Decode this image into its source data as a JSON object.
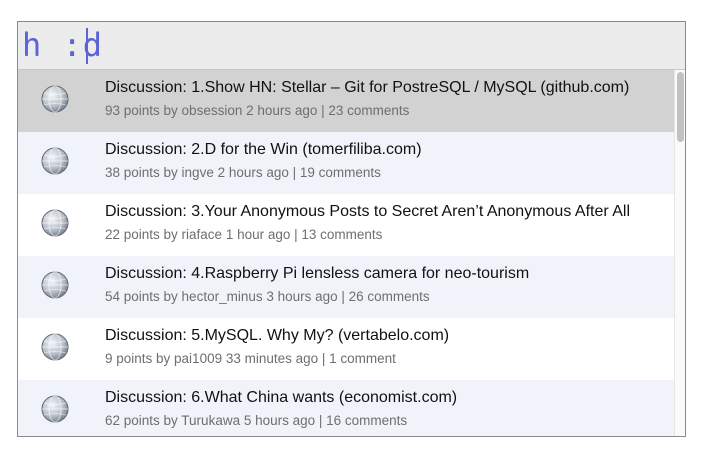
{
  "search": {
    "query": "h :d"
  },
  "results": [
    {
      "title": "Discussion: 1.Show HN: Stellar – Git for PostreSQL / MySQL (github.com)",
      "meta": "93 points by obsession 2 hours ago | 23 comments"
    },
    {
      "title": "Discussion: 2.D for the Win (tomerfiliba.com)",
      "meta": "38 points by ingve 2 hours ago | 19 comments"
    },
    {
      "title": "Discussion: 3.Your Anonymous Posts to Secret Aren’t Anonymous After All",
      "meta": "22 points by riaface 1 hour ago | 13 comments"
    },
    {
      "title": "Discussion: 4.Raspberry Pi lensless camera for neo-tourism",
      "meta": "54 points by hector_minus 3 hours ago | 26 comments"
    },
    {
      "title": "Discussion: 5.MySQL. Why My? (vertabelo.com)",
      "meta": "9 points by pai1009 33 minutes ago | 1 comment"
    },
    {
      "title": "Discussion: 6.What China wants (economist.com)",
      "meta": "62 points by Turukawa 5 hours ago | 16 comments"
    }
  ],
  "icons": {
    "result_icon": "globe-icon"
  },
  "colors": {
    "query_text": "#5a63d8",
    "selected_row": "#d2d2d2",
    "alt_row": "#f0f4fa"
  }
}
